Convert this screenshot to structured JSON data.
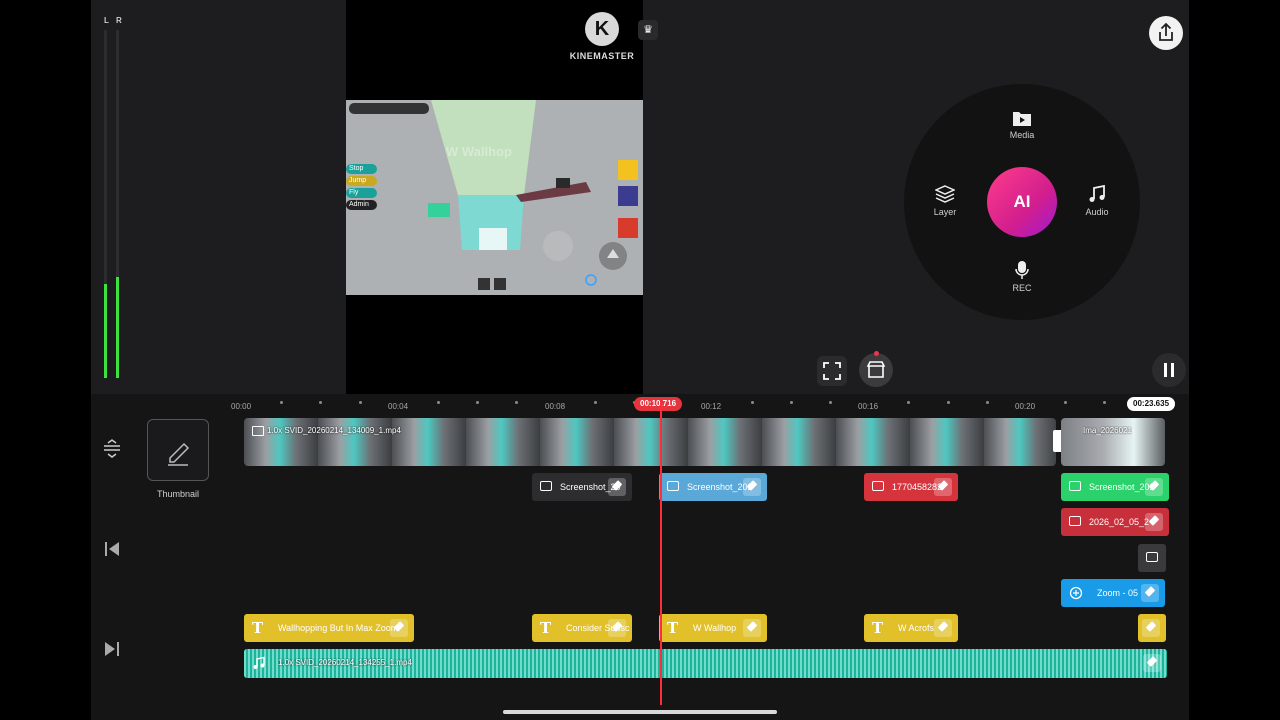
{
  "meter": {
    "left_label": "L",
    "right_label": "R",
    "left_level": 0.27,
    "right_level": 0.29
  },
  "brand": {
    "name": "KINEMASTER",
    "logo_letter": "K"
  },
  "preview": {
    "scene": "game-capture",
    "hud_buttons": [
      "Stop",
      "Jump",
      "Fly",
      "Admin"
    ],
    "center_text": "W Wallhop"
  },
  "radial_menu": {
    "media_label": "Media",
    "layer_label": "Layer",
    "audio_label": "Audio",
    "rec_label": "REC",
    "ai_label": "AI"
  },
  "timeline": {
    "ruler": [
      "00:00",
      "00:04",
      "00:08",
      "00:12",
      "00:16",
      "00:20"
    ],
    "current_time": "00:10.716",
    "total_time": "00:23.635",
    "thumbnail_label": "Thumbnail",
    "video_clip_label": "1.0x SVID_20260214_134009_1.mp4",
    "video_clip2_label": "Ima_2026021",
    "image_layers": [
      {
        "label": "Screenshot_20",
        "color": "#3a3a3c"
      },
      {
        "label": "Screenshot_202",
        "color": "#5aa8d8"
      },
      {
        "label": "1770458282",
        "color": "#d6343c"
      },
      {
        "label": "Screenshot_202",
        "color": "#2bd16a"
      },
      {
        "label": "2026_02_05_2",
        "color": "#c72f3a"
      }
    ],
    "effect_layer": {
      "label": "Zoom - 05",
      "color": "#1a9be8"
    },
    "text_layers": [
      "Wallhopping But In Max Zoom",
      "Consider Subsc",
      "W Wallhop",
      "W Acrofs"
    ],
    "audio_clip_label": "1.0x SVID_20260214_134255_1.mp4"
  },
  "colors": {
    "accent": "#ff2d3c",
    "text_layer": "#e1c02a",
    "audio": "#1db49b"
  }
}
